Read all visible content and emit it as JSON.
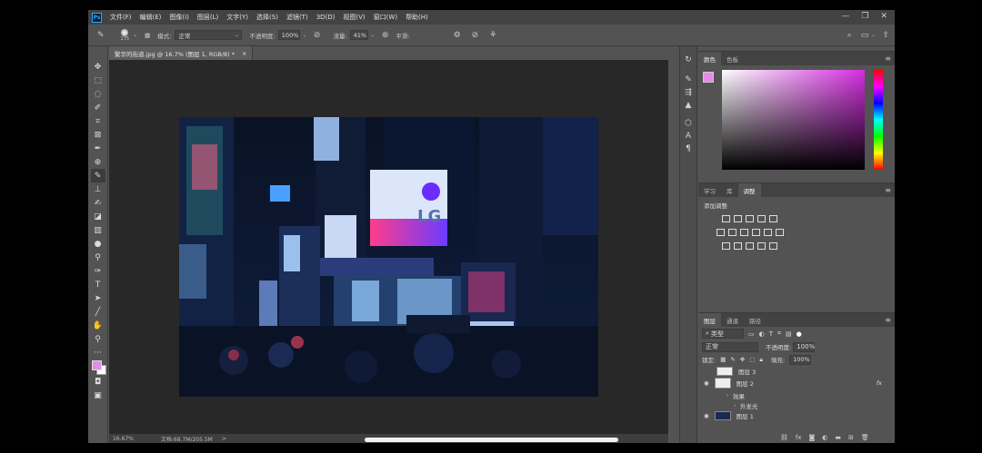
{
  "menubar": {
    "logo": "Ps",
    "items": [
      "文件(F)",
      "编辑(E)",
      "图像(I)",
      "图层(L)",
      "文字(Y)",
      "选择(S)",
      "滤镜(T)",
      "3D(D)",
      "视图(V)",
      "窗口(W)",
      "帮助(H)"
    ],
    "controls": [
      "—",
      "❐",
      "✕"
    ]
  },
  "options": {
    "brush_size": "175",
    "mode_label": "模式:",
    "mode_value": "正常",
    "opacity_label": "不透明度:",
    "opacity_value": "100%",
    "flow_label": "流量:",
    "flow_value": "41%",
    "smooth_label": "平滑:"
  },
  "document": {
    "tab_title": "繁华的街道.jpg @ 16.7% (图层 1, RGB/8) *",
    "tab_close": "×",
    "status_zoom": "16.67%",
    "status_doc": "文档:68.7M/205.5M",
    "status_arrow": ">"
  },
  "photo": {
    "sign_lg": "LG"
  },
  "colors_panel": {
    "tabs": [
      "颜色",
      "色板"
    ],
    "foreground": "#e58ae6",
    "background": "#ffffff"
  },
  "adjust_panel": {
    "tabs": [
      "学习",
      "库",
      "调整"
    ],
    "title": "添加调整"
  },
  "layers_panel": {
    "tabs": [
      "图层",
      "通道",
      "路径"
    ],
    "filter_value": "类型",
    "blend_mode": "正常",
    "opacity_label": "不透明度:",
    "opacity_value": "100%",
    "lock_label": "锁定:",
    "fill_label": "填充:",
    "fill_value": "100%",
    "layers": [
      {
        "name": "图层 3"
      },
      {
        "name": "图层 2",
        "fx": "fx"
      },
      {
        "name": "效果"
      },
      {
        "name": "外发光"
      },
      {
        "name": "图层 1"
      }
    ]
  },
  "icons": [
    "photoshop-logo",
    "brush-tool-icon",
    "move-tool-icon",
    "search-icon",
    "share-icon"
  ]
}
